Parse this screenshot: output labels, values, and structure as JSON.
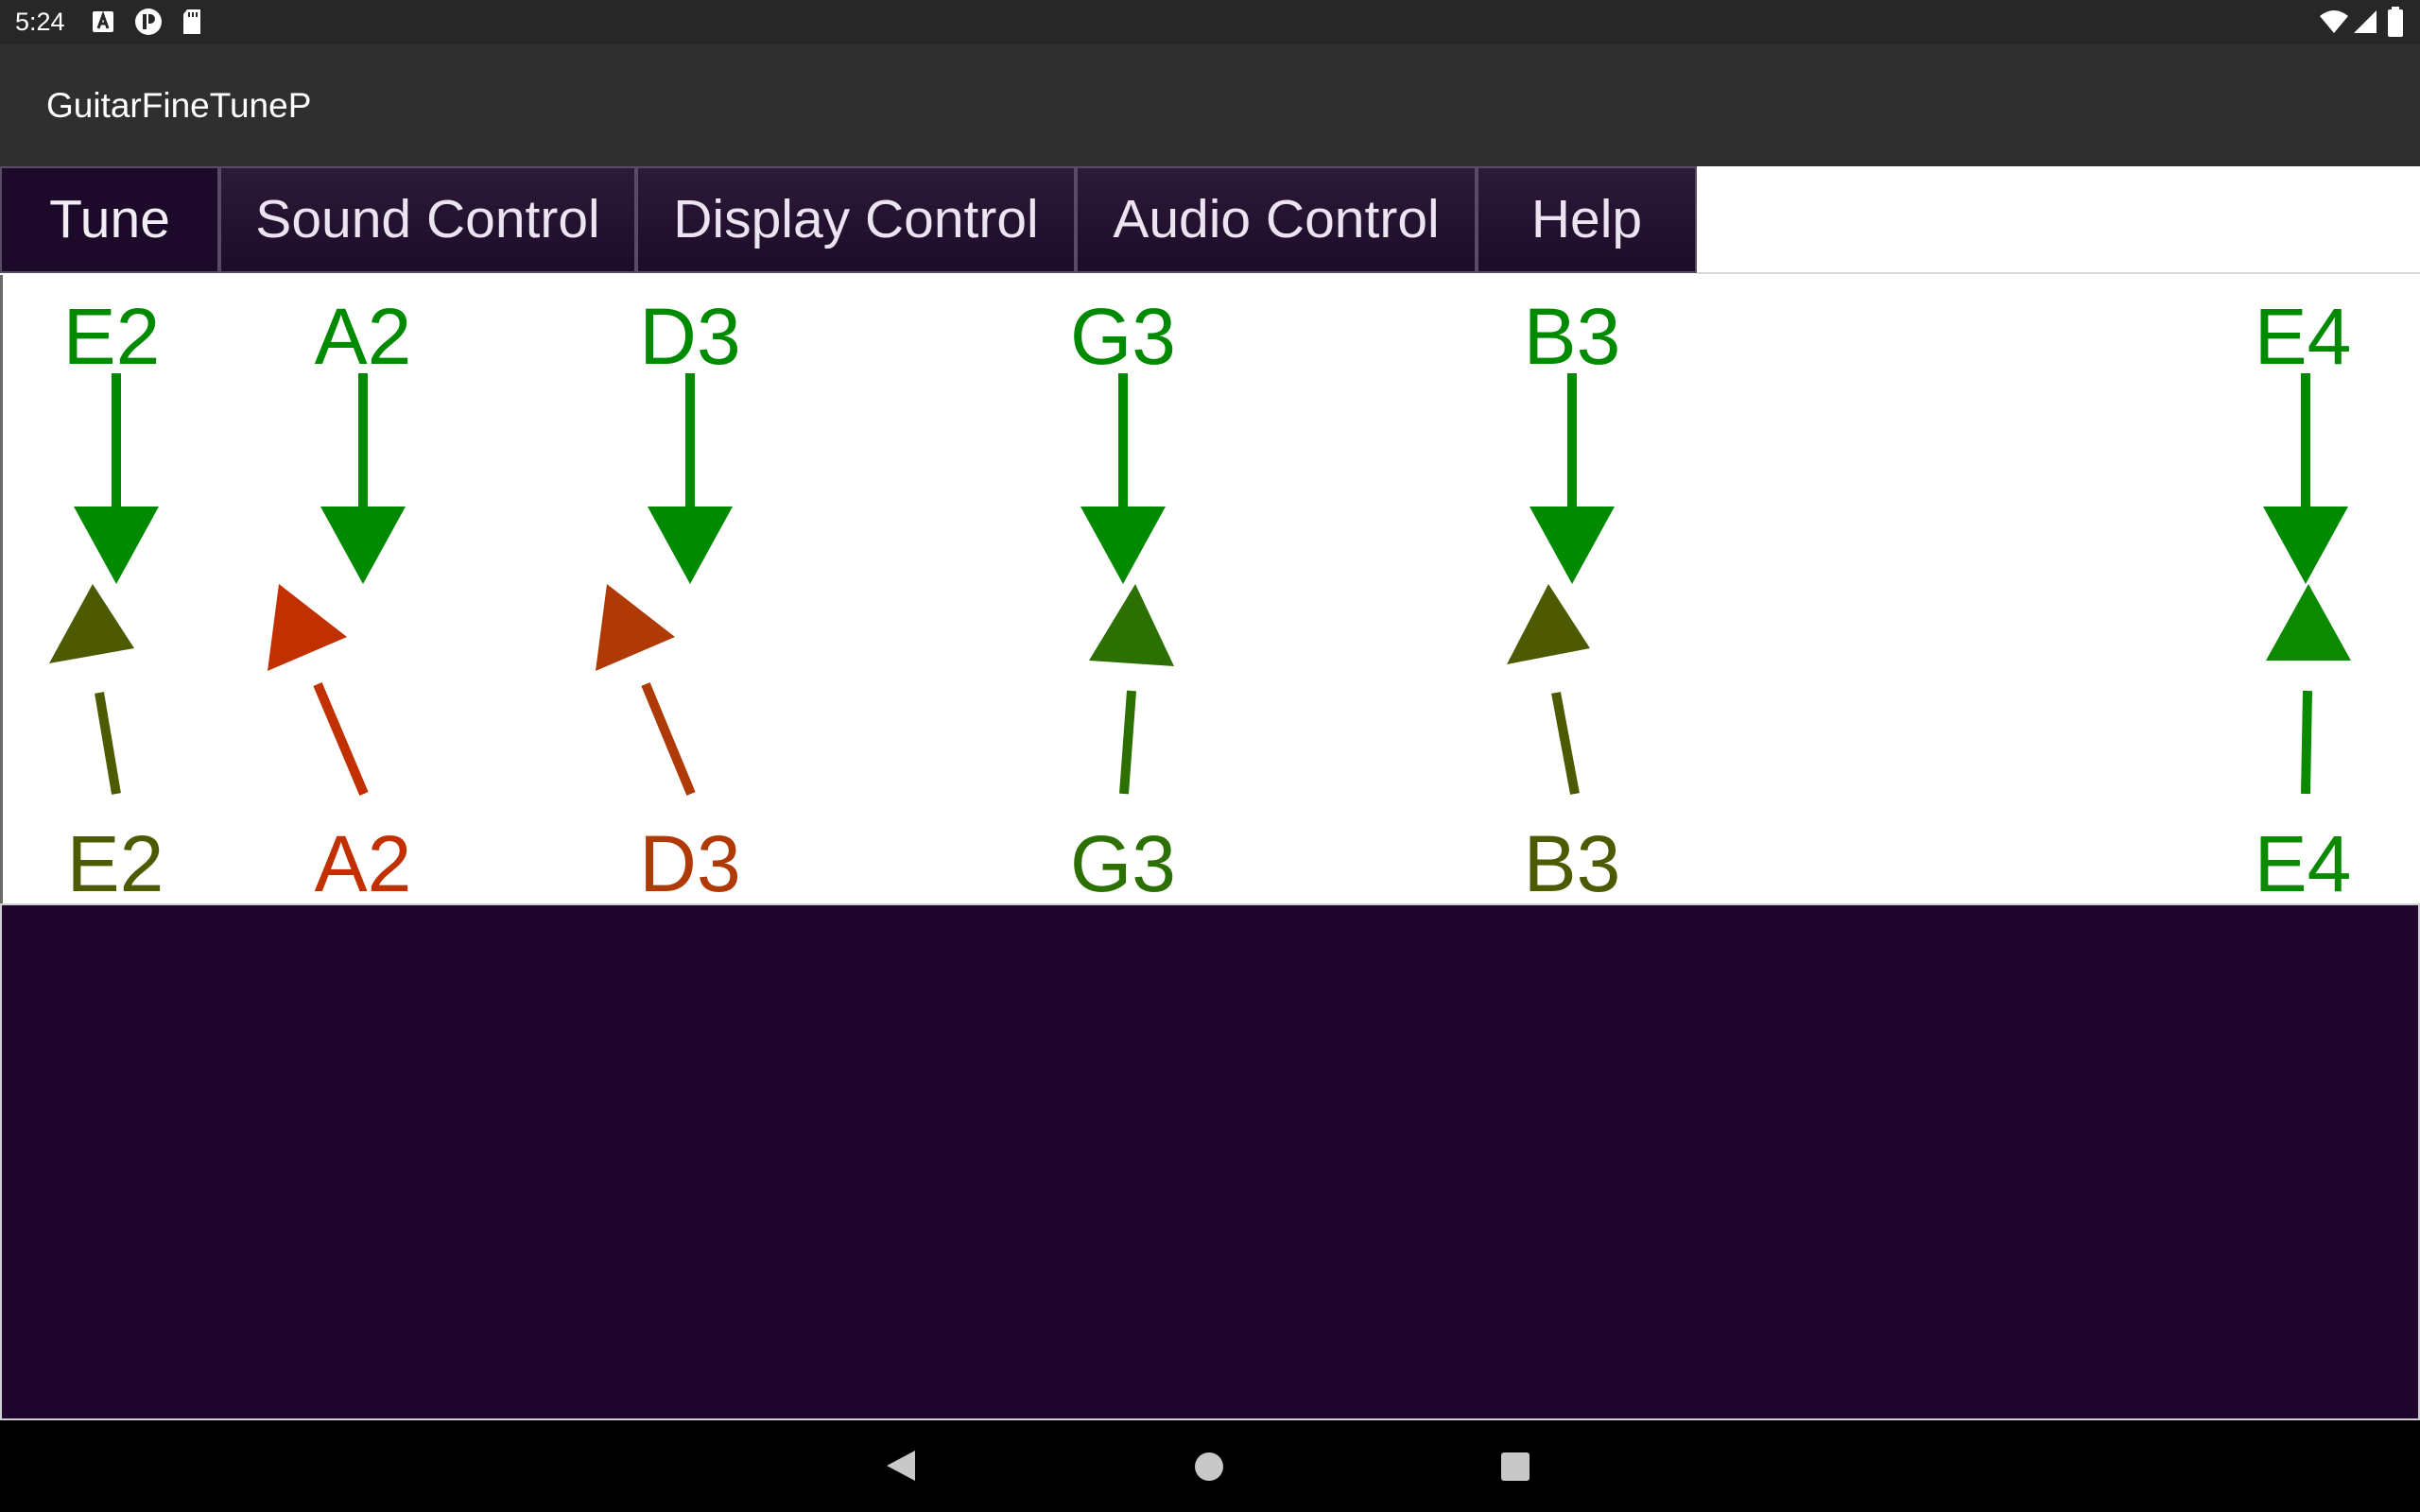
{
  "status_bar": {
    "time": "5:24",
    "left_icons": [
      "a-notification-icon",
      "p-notification-icon",
      "sd-card-icon"
    ],
    "right_icons": [
      "wifi-icon",
      "cell-signal-icon",
      "battery-icon"
    ]
  },
  "app": {
    "title": "GuitarFineTuneP"
  },
  "tabs": [
    {
      "label": "Tune",
      "active": true
    },
    {
      "label": "Sound Control",
      "active": false
    },
    {
      "label": "Display Control",
      "active": false
    },
    {
      "label": "Audio Control",
      "active": false
    },
    {
      "label": "Help",
      "active": false
    }
  ],
  "tuner": {
    "target_notes": [
      "E2",
      "A2",
      "D3",
      "G3",
      "B3",
      "E4"
    ],
    "target_color": "#008a00",
    "detected_notes": [
      {
        "label": "E2",
        "color": "#4d5a00"
      },
      {
        "label": "A2",
        "color": "#c23000"
      },
      {
        "label": "D3",
        "color": "#b03a06"
      },
      {
        "label": "G3",
        "color": "#2b7000"
      },
      {
        "label": "B3",
        "color": "#4d5a00"
      },
      {
        "label": "E4",
        "color": "#0b8a00"
      }
    ]
  },
  "colors": {
    "status_bar": "#272727",
    "action_bar": "#2f2f2f",
    "tab_background": "#1d0c29",
    "dark_panel": "#20062c"
  },
  "nav_bar": {
    "icons": [
      "back-icon",
      "home-icon",
      "recents-icon"
    ]
  }
}
